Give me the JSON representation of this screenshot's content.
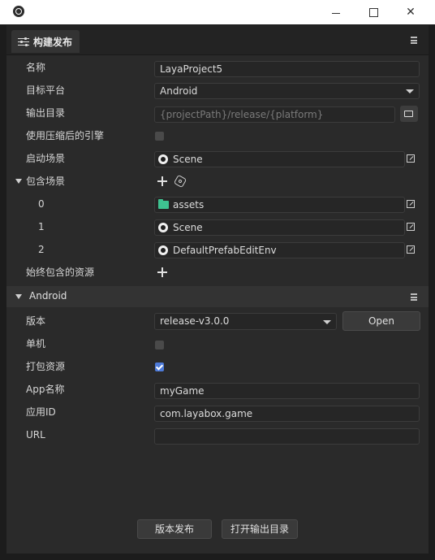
{
  "window": {
    "app_icon": "electron-icon",
    "controls": [
      "minimize-icon",
      "maximize-icon",
      "close-icon"
    ]
  },
  "tab": {
    "label": "构建发布",
    "icon": "sliders-icon"
  },
  "fields": {
    "name": {
      "label": "名称",
      "value": "LayaProject5"
    },
    "platform": {
      "label": "目标平台",
      "value": "Android"
    },
    "output_dir": {
      "label": "输出目录",
      "placeholder": "{projectPath}/release/{platform}"
    },
    "compressed_engine": {
      "label": "使用压缩后的引擎",
      "checked": false
    },
    "start_scene": {
      "label": "启动场景",
      "value": "Scene"
    },
    "include_scenes": {
      "label": "包含场景",
      "items": [
        {
          "index": "0",
          "value": "assets"
        },
        {
          "index": "1",
          "value": "Scene"
        },
        {
          "index": "2",
          "value": "DefaultPrefabEditEnv"
        }
      ]
    },
    "always_include": {
      "label": "始终包含的资源"
    }
  },
  "android": {
    "title": "Android",
    "version": {
      "label": "版本",
      "value": "release-v3.0.0",
      "open_button": "Open"
    },
    "standalone": {
      "label": "单机",
      "checked": false
    },
    "pack_resources": {
      "label": "打包资源",
      "checked": true
    },
    "app_name": {
      "label": "App名称",
      "value": "myGame"
    },
    "app_id": {
      "label": "应用ID",
      "value": "com.layabox.game"
    },
    "url": {
      "label": "URL",
      "value": ""
    }
  },
  "actions": {
    "publish": "版本发布",
    "open_output": "打开输出目录"
  },
  "colors": {
    "accent": "#4d7ad8",
    "asset_folder": "#3ec290"
  }
}
